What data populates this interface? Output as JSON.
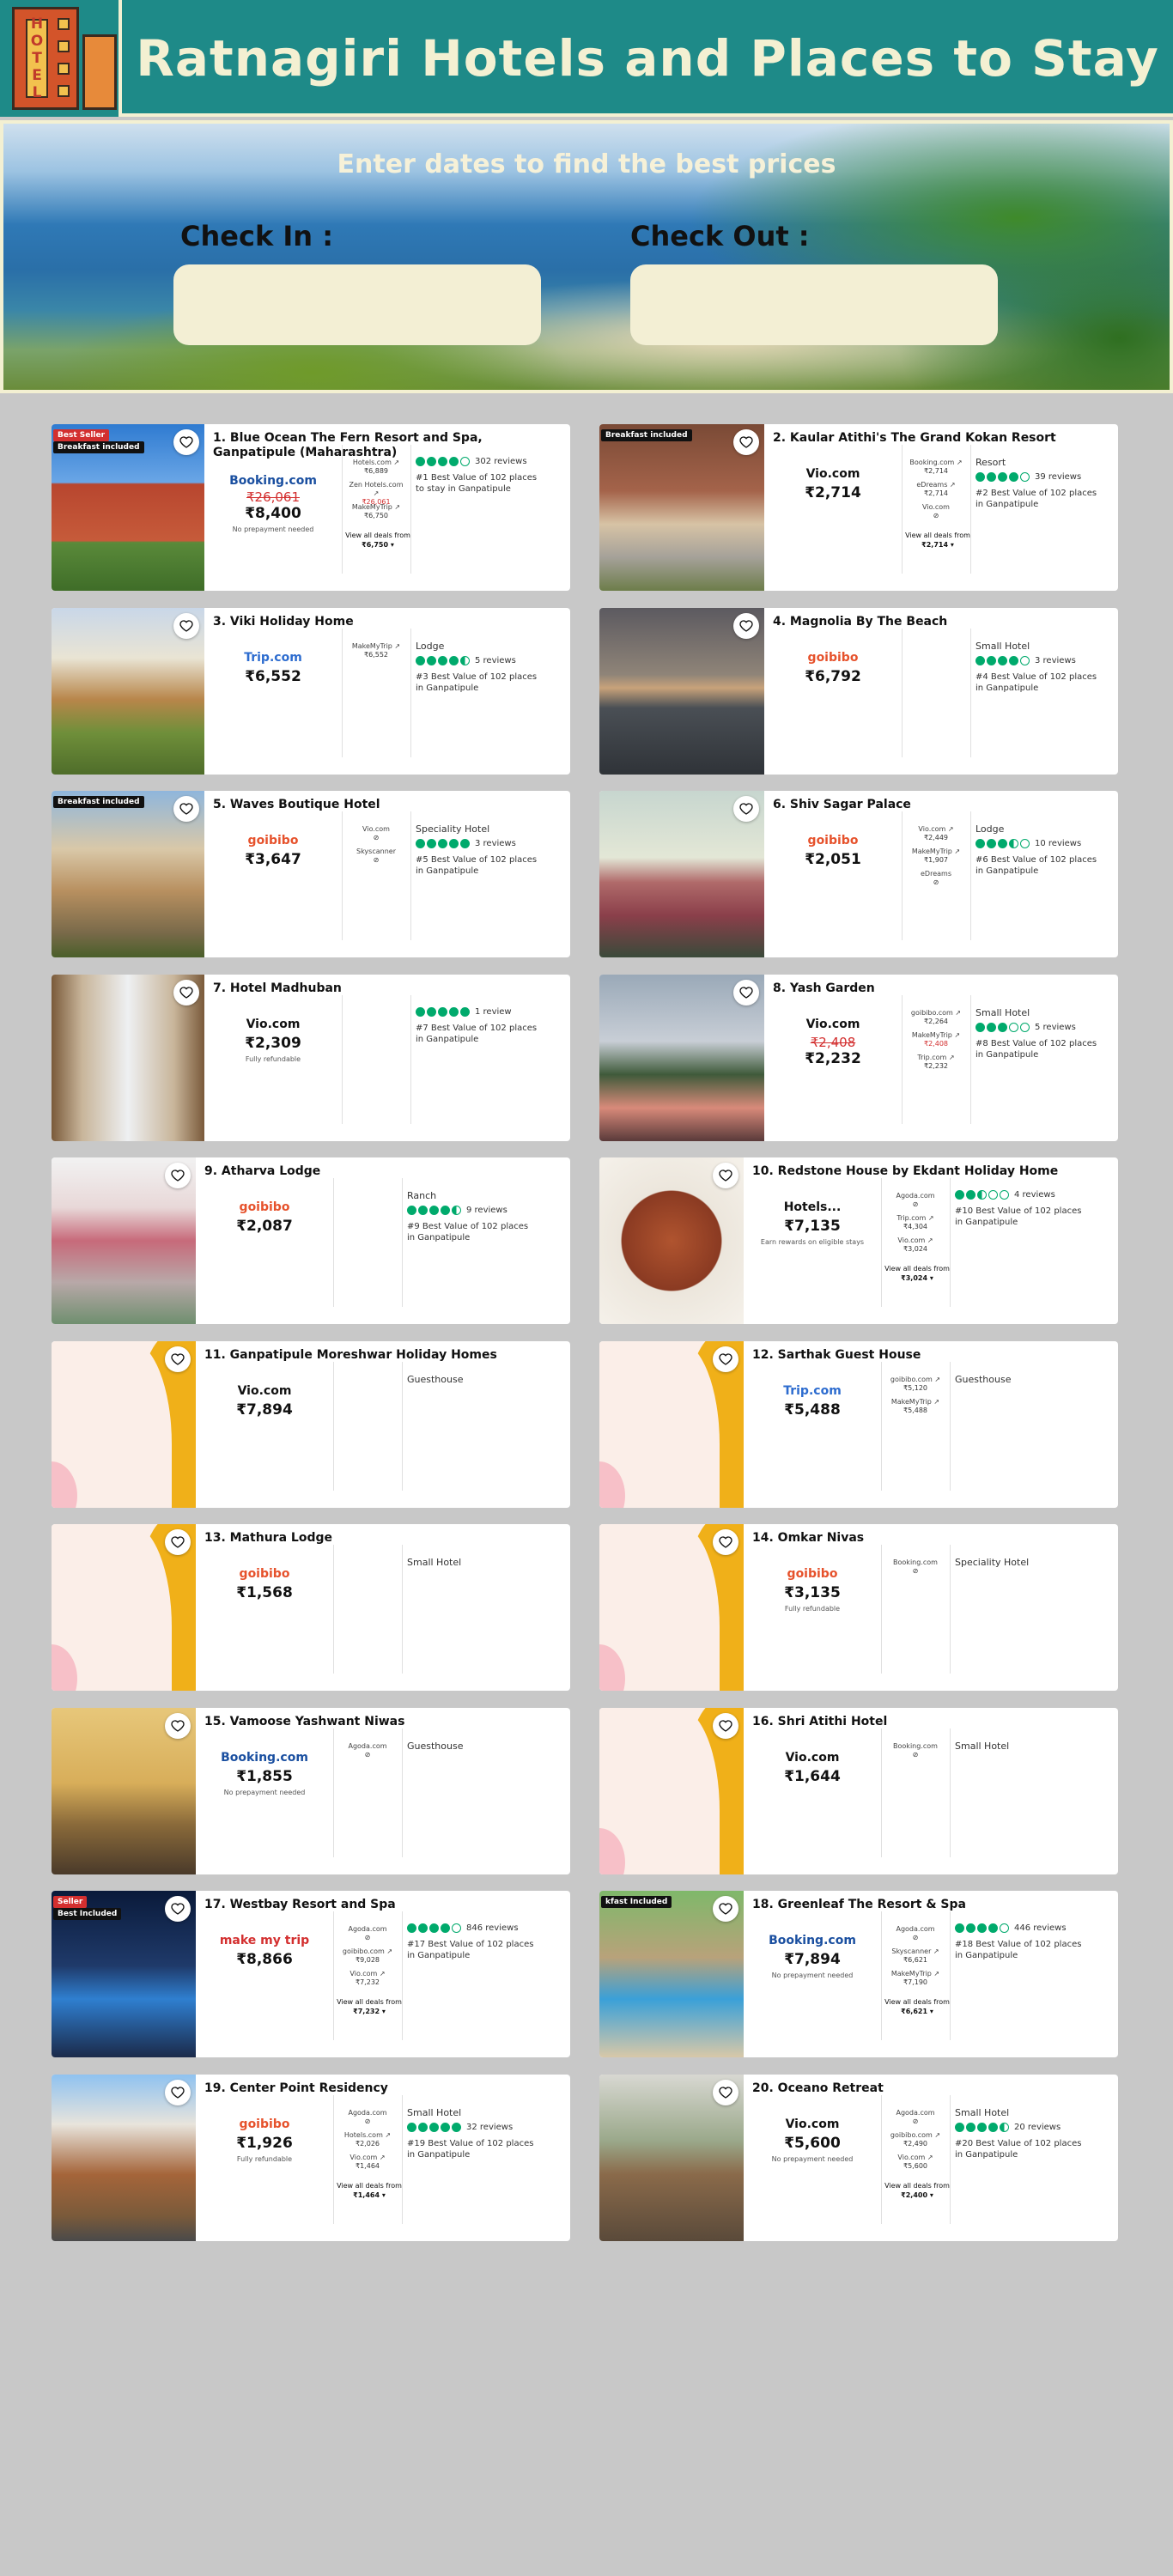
{
  "site": {
    "title": "Ratnagiri Hotels and Places to Stay",
    "logo_text": "HOTEL"
  },
  "hero": {
    "title": "Enter dates to find the best prices",
    "check_in_label": "Check In :",
    "check_out_label": "Check Out :"
  },
  "hotels": [
    {
      "name": "1. Blue Ocean The Fern Resort and Spa, Ganpatipule (Maharashtra)",
      "provider": "Booking.com",
      "old_price": "₹26,061",
      "price": "₹8,400",
      "note": "No prepayment needed",
      "side": [
        [
          "Hotels.com ↗",
          "₹6,889"
        ],
        [
          "Zen Hotels.com ↗",
          "₹26,061"
        ],
        [
          "MakeMyTrip ↗",
          "₹6,750"
        ]
      ],
      "deals": "View all deals from",
      "deals_from": "₹6,750 ▾",
      "badge1": "Best Seller",
      "badge2": "Breakfast included",
      "reviews": "302 reviews",
      "best": "#1 Best Value of 102 places to stay in Ganpatipule",
      "type": ""
    },
    {
      "name": "2. Kaular Atithi's The Grand Kokan Resort",
      "provider": "Vio.com",
      "price": "₹2,714",
      "side": [
        [
          "Booking.com ↗",
          "₹2,714"
        ],
        [
          "eDreams ↗",
          "₹2,714"
        ],
        [
          "Vio.com",
          "⊘"
        ]
      ],
      "deals": "View all deals from",
      "deals_from": "₹2,714 ▾",
      "badge1": "Breakfast included",
      "type": "Resort",
      "reviews": "39 reviews",
      "best": "#2 Best Value of 102 places in Ganpatipule"
    },
    {
      "name": "3. Viki Holiday Home",
      "provider": "Trip.com",
      "price": "₹6,552",
      "side": [
        [
          "MakeMyTrip ↗",
          "₹6,552"
        ]
      ],
      "type": "Lodge",
      "reviews": "5 reviews",
      "best": "#3 Best Value of 102 places in Ganpatipule"
    },
    {
      "name": "4. Magnolia By The Beach",
      "provider": "goibibo",
      "price": "₹6,792",
      "type": "Small Hotel",
      "reviews": "3 reviews",
      "best": "#4 Best Value of 102 places in Ganpatipule"
    },
    {
      "name": "5. Waves Boutique Hotel",
      "provider": "goibibo",
      "price": "₹3,647",
      "side": [
        [
          "Vio.com",
          "⊘"
        ],
        [
          "Skyscanner",
          "⊘"
        ]
      ],
      "badge1": "Breakfast included",
      "type": "Speciality Hotel",
      "reviews": "3 reviews",
      "best": "#5 Best Value of 102 places in Ganpatipule"
    },
    {
      "name": "6. Shiv Sagar Palace",
      "provider": "goibibo",
      "price": "₹2,051",
      "side": [
        [
          "Vio.com ↗",
          "₹2,449"
        ],
        [
          "MakeMyTrip ↗",
          "₹1,907"
        ],
        [
          "eDreams",
          "⊘"
        ]
      ],
      "type": "Lodge",
      "reviews": "10 reviews",
      "best": "#6 Best Value of 102 places in Ganpatipule"
    },
    {
      "name": "7. Hotel Madhuban",
      "provider": "Vio.com",
      "price": "₹2,309",
      "note": "Fully refundable",
      "type": "",
      "reviews": "1 review",
      "best": "#7 Best Value of 102 places in Ganpatipule"
    },
    {
      "name": "8. Yash Garden",
      "provider": "Vio.com",
      "old_price": "₹2,408",
      "price": "₹2,232",
      "side": [
        [
          "goibibo.com ↗",
          "₹2,264"
        ],
        [
          "MakeMyTrip ↗",
          "₹2,408"
        ],
        [
          "Trip.com ↗",
          "₹2,232"
        ]
      ],
      "type": "Small Hotel",
      "reviews": "5 reviews",
      "best": "#8 Best Value of 102 places in Ganpatipule"
    },
    {
      "name": "9. Atharva Lodge",
      "provider": "goibibo",
      "price": "₹2,087",
      "type": "Ranch",
      "reviews": "9 reviews",
      "best": "#9 Best Value of 102 places in Ganpatipule"
    },
    {
      "name": "10. Redstone House by Ekdant Holiday Home",
      "provider": "Hotels...",
      "price": "₹7,135",
      "note": "Earn rewards on eligible stays",
      "side": [
        [
          "Agoda.com",
          "⊘"
        ],
        [
          "Trip.com ↗",
          "₹4,304"
        ],
        [
          "Vio.com ↗",
          "₹3,024"
        ]
      ],
      "deals": "View all deals from",
      "deals_from": "₹3,024 ▾",
      "type": "",
      "reviews": "4 reviews",
      "best": "#10 Best Value of 102 places in Ganpatipule"
    },
    {
      "name": "11. Ganpatipule Moreshwar Holiday Homes",
      "provider": "Vio.com",
      "price": "₹7,894",
      "type": "Guesthouse"
    },
    {
      "name": "12. Sarthak Guest House",
      "provider": "Trip.com",
      "price": "₹5,488",
      "side": [
        [
          "goibibo.com ↗",
          "₹5,120"
        ],
        [
          "MakeMyTrip ↗",
          "₹5,488"
        ]
      ],
      "type": "Guesthouse"
    },
    {
      "name": "13. Mathura Lodge",
      "provider": "goibibo",
      "price": "₹1,568",
      "type": "Small Hotel"
    },
    {
      "name": "14. Omkar Nivas",
      "provider": "goibibo",
      "price": "₹3,135",
      "note": "Fully refundable",
      "side": [
        [
          "Booking.com",
          "⊘"
        ]
      ],
      "type": "Speciality Hotel"
    },
    {
      "name": "15. Vamoose Yashwant Niwas",
      "provider": "Booking.com",
      "price": "₹1,855",
      "note": "No prepayment needed",
      "side": [
        [
          "Agoda.com",
          "⊘"
        ]
      ],
      "type": "Guesthouse"
    },
    {
      "name": "16. Shri Atithi Hotel",
      "provider": "Vio.com",
      "price": "₹1,644",
      "side": [
        [
          "Booking.com",
          "⊘"
        ]
      ],
      "type": "Small Hotel"
    },
    {
      "name": "17. Westbay Resort and Spa",
      "provider": "make my trip",
      "price": "₹8,866",
      "side": [
        [
          "Agoda.com",
          "⊘"
        ],
        [
          "goibibo.com ↗",
          "₹9,028"
        ],
        [
          "Vio.com ↗",
          "₹7,232"
        ]
      ],
      "deals": "View all deals from",
      "deals_from": "₹7,232 ▾",
      "badge1": "Seller",
      "badge2": "Best Included",
      "reviews": "846 reviews",
      "best": "#17 Best Value of 102 places in Ganpatipule",
      "type": ""
    },
    {
      "name": "18. Greenleaf The Resort & Spa",
      "provider": "Booking.com",
      "price": "₹7,894",
      "note": "No prepayment needed",
      "side": [
        [
          "Agoda.com",
          "⊘"
        ],
        [
          "Skyscanner ↗",
          "₹6,621"
        ],
        [
          "MakeMyTrip ↗",
          "₹7,190"
        ]
      ],
      "deals": "View all deals from",
      "deals_from": "₹6,621 ▾",
      "badge1": "kfast Included",
      "reviews": "446 reviews",
      "best": "#18 Best Value of 102 places in Ganpatipule",
      "type": ""
    },
    {
      "name": "19. Center Point Residency",
      "provider": "goibibo",
      "price": "₹1,926",
      "note": "Fully refundable",
      "side": [
        [
          "Agoda.com",
          "⊘"
        ],
        [
          "Hotels.com ↗",
          "₹2,026"
        ],
        [
          "Vio.com ↗",
          "₹1,464"
        ]
      ],
      "deals": "View all deals from",
      "deals_from": "₹1,464 ▾",
      "type": "Small Hotel",
      "reviews": "32 reviews",
      "best": "#19 Best Value of 102 places in Ganpatipule"
    },
    {
      "name": "20. Oceano Retreat",
      "provider": "Vio.com",
      "price": "₹5,600",
      "note": "No prepayment needed",
      "side": [
        [
          "Agoda.com",
          "⊘"
        ],
        [
          "goibibo.com ↗",
          "₹2,490"
        ],
        [
          "Vio.com ↗",
          "₹5,600"
        ]
      ],
      "deals": "View all deals from",
      "deals_from": "₹2,400 ▾",
      "type": "Small Hotel",
      "reviews": "20 reviews",
      "best": "#20 Best Value of 102 places in Ganpatipule"
    }
  ],
  "ratings": [
    4,
    4,
    4.5,
    4,
    5,
    3.5,
    5,
    3,
    4.5,
    2.5,
    0,
    0,
    0,
    0,
    0,
    0,
    4,
    4,
    5,
    4.5
  ],
  "photo_styles": [
    "resort-red",
    "heritage",
    "villa",
    "sunset",
    "boutique",
    "palace",
    "room",
    "palms",
    "lodge",
    "food",
    "placeholder",
    "placeholder",
    "placeholder",
    "placeholder",
    "yellow-building",
    "placeholder",
    "pool-night",
    "pool-day",
    "balconies",
    "terrace"
  ],
  "colors": {
    "header_bg": "#1e8a88",
    "header_text": "#f3f0d2",
    "page_bg": "#c8c8c8",
    "rating_green": "#00aa6c",
    "strike_red": "#d32f2f"
  }
}
